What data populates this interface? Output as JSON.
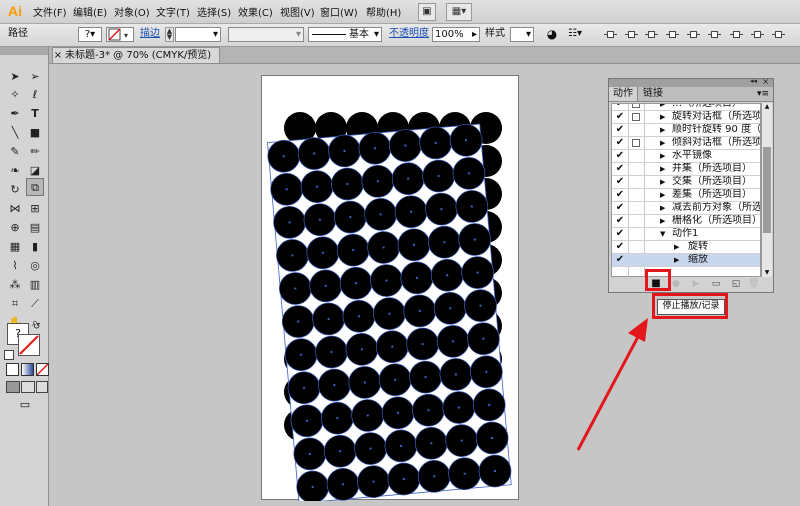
{
  "app": {
    "logo": "Ai"
  },
  "menu": [
    "文件(F)",
    "编辑(E)",
    "对象(O)",
    "文字(T)",
    "选择(S)",
    "效果(C)",
    "视图(V)",
    "窗口(W)",
    "帮助(H)"
  ],
  "menu_icons": [
    "bridge-icon",
    "arrange-documents-icon"
  ],
  "control_bar": {
    "selection_label": "路径",
    "fill_value": "?",
    "stroke_label": "描边",
    "stroke_weight": "",
    "brush_label": "基本",
    "opacity_label": "不透明度",
    "opacity_value": "100%",
    "style_label": "样式"
  },
  "document_tab": {
    "title": "未标题-3* @ 70% (CMYK/预览)",
    "close": "×"
  },
  "tools_panel": {
    "fill_value": "?"
  },
  "actions_panel": {
    "tabs": [
      "动作",
      "链接"
    ],
    "rows": [
      {
        "checked": true,
        "dialog": true,
        "indent": 1,
        "label": "…（所选项目）",
        "expand": "▶"
      },
      {
        "checked": true,
        "dialog": true,
        "indent": 1,
        "label": "旋转对话框（所选项...",
        "expand": "▶"
      },
      {
        "checked": true,
        "dialog": false,
        "indent": 1,
        "label": "顺时针旋转 90 度（...",
        "expand": "▶"
      },
      {
        "checked": true,
        "dialog": true,
        "indent": 1,
        "label": "倾斜对话框（所选项...",
        "expand": "▶"
      },
      {
        "checked": true,
        "dialog": false,
        "indent": 1,
        "label": "水平镜像",
        "expand": "▶"
      },
      {
        "checked": true,
        "dialog": false,
        "indent": 1,
        "label": "并集（所选项目）",
        "expand": "▶"
      },
      {
        "checked": true,
        "dialog": false,
        "indent": 1,
        "label": "交集（所选项目）",
        "expand": "▶"
      },
      {
        "checked": true,
        "dialog": false,
        "indent": 1,
        "label": "差集（所选项目）",
        "expand": "▶"
      },
      {
        "checked": true,
        "dialog": false,
        "indent": 1,
        "label": "减去前方对象（所选...",
        "expand": "▶"
      },
      {
        "checked": true,
        "dialog": false,
        "indent": 1,
        "label": "栅格化（所选项目）",
        "expand": "▶"
      },
      {
        "checked": true,
        "dialog": false,
        "indent": 1,
        "label": "动作1",
        "expand": "▼"
      },
      {
        "checked": true,
        "dialog": false,
        "indent": 2,
        "label": "旋转",
        "expand": "▶"
      },
      {
        "checked": true,
        "dialog": false,
        "indent": 2,
        "label": "缩放",
        "expand": "▶",
        "highlighted": true
      }
    ],
    "footer_buttons": [
      "stop-icon",
      "record-icon",
      "play-icon",
      "new-set-icon",
      "new-action-icon",
      "delete-icon"
    ]
  },
  "tooltip": {
    "text": "停止播放/记录"
  },
  "colors": {
    "highlight_red": "#e3161b",
    "selection_blue": "#3f5fc4",
    "circle_fill": "#000000",
    "ai_orange": "#ff9a00"
  }
}
